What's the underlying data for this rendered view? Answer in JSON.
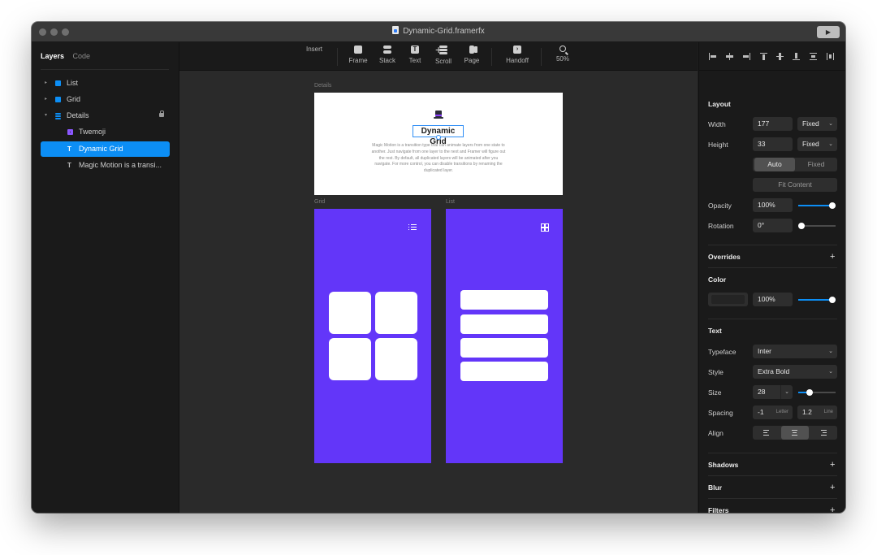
{
  "window": {
    "title": "Dynamic-Grid.framerfx"
  },
  "left_panel": {
    "tabs": [
      "Layers",
      "Code"
    ],
    "layers": [
      {
        "name": "List",
        "icon": "frame-icon"
      },
      {
        "name": "Grid",
        "icon": "frame-icon"
      },
      {
        "name": "Details",
        "icon": "stack-icon"
      },
      {
        "name": "Twemoji",
        "icon": "component-icon"
      },
      {
        "name": "Dynamic Grid",
        "icon": "text-icon"
      },
      {
        "name": "Magic Motion is a transi...",
        "icon": "text-icon"
      }
    ]
  },
  "toolbar": {
    "items": [
      "Insert",
      "Frame",
      "Stack",
      "Text",
      "Scroll",
      "Page",
      "Handoff",
      "50%"
    ]
  },
  "canvas": {
    "frames": {
      "details": "Details",
      "grid": "Grid",
      "list": "List"
    },
    "details_title": "Dynamic Grid",
    "details_desc": "Magic Motion is a transition type that can animate layers from one state to another. Just navigate from one layer to the next and Framer will figure out the rest. By default, all duplicated layers will be animated after you navigate. For more control, you can disable transitions by renaming the duplicated layer."
  },
  "right_panel": {
    "layout": {
      "heading": "Layout",
      "width_label": "Width",
      "width": "177",
      "width_mode": "Fixed",
      "height_label": "Height",
      "height": "33",
      "height_mode": "Fixed",
      "auto": "Auto",
      "fixed": "Fixed",
      "fit_content": "Fit Content",
      "opacity_label": "Opacity",
      "opacity": "100%",
      "opacity_level": 1.0,
      "rotation_label": "Rotation",
      "rotation": "0°",
      "rotation_level": 0.0
    },
    "overrides": "Overrides",
    "color": {
      "heading": "Color",
      "opacity": "100%",
      "level": 1.0
    },
    "text": {
      "heading": "Text",
      "typeface_label": "Typeface",
      "typeface": "Inter",
      "style_label": "Style",
      "style": "Extra Bold",
      "size_label": "Size",
      "size": "28",
      "spacing_label": "Spacing",
      "letter": "-1",
      "letter_unit": "Letter",
      "line": "1.2",
      "line_unit": "Line",
      "align_label": "Align",
      "align_selected": "center"
    },
    "shadows": "Shadows",
    "blur": "Blur",
    "filters": "Filters"
  },
  "colors": {
    "accent": "#0c8ef5",
    "frame_purple": "#6336f9"
  }
}
